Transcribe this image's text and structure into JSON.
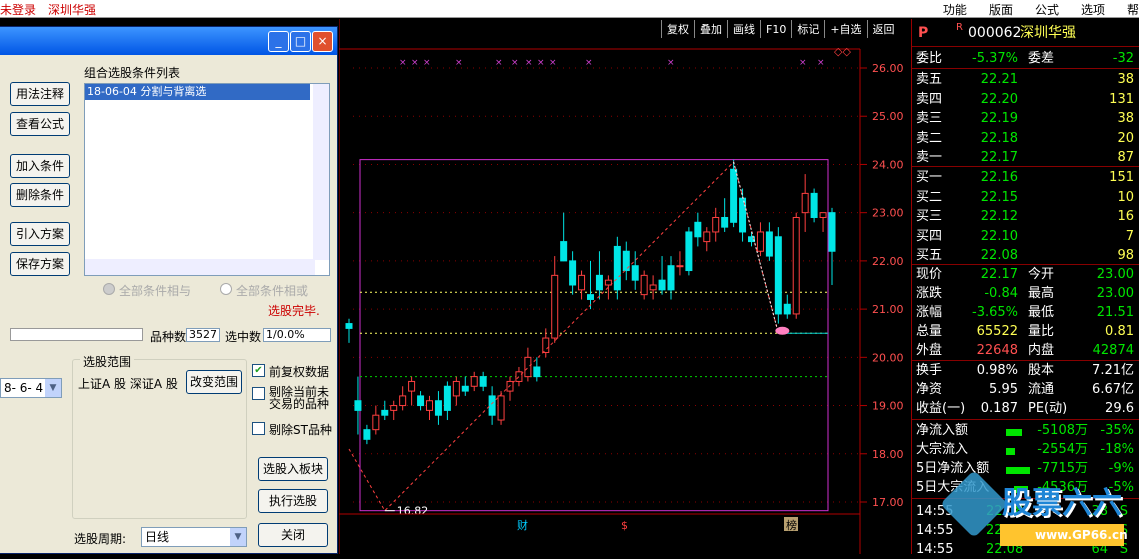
{
  "top": {
    "left1": "未登录",
    "left2": "深圳华强",
    "menu": [
      "功能",
      "版面",
      "公式",
      "选项",
      "帮"
    ]
  },
  "dialog": {
    "title_buttons": [
      "_",
      "□",
      "×"
    ],
    "list_header": "组合选股条件列表",
    "list_item": "18-06-04 分割与背离选",
    "buttons": {
      "usage": "用法注释",
      "view_formula": "查看公式",
      "add": "加入条件",
      "delete": "删除条件",
      "import": "引入方案",
      "save": "保存方案",
      "change_range": "改变范围",
      "to_block": "选股入板块",
      "execute": "执行选股",
      "close": "关闭"
    },
    "radio1": "全部条件相与",
    "radio2": "全部条件相或",
    "done": "选股完毕.",
    "count_label": "品种数",
    "count_value": "3527",
    "select_label": "选中数",
    "select_value": "1/0.0%",
    "range_title": "选股范围",
    "range_value": "上证A 股 深证A 股",
    "date_value": "8- 6- 4",
    "checks": [
      "前复权数据",
      "剔除当前未交易的品种",
      "剔除ST品种"
    ],
    "check_states": [
      true,
      false,
      false
    ],
    "period_label": "选股周期:",
    "period_value": "日线"
  },
  "toolbar": [
    "复权",
    "叠加",
    "画线",
    "F10",
    "标记",
    "+自选",
    "返回"
  ],
  "chart_data": {
    "type": "candlestick",
    "y_ticks": [
      "26.00",
      "25.00",
      "24.00",
      "23.00",
      "22.00",
      "21.00",
      "20.00",
      "19.00",
      "18.00",
      "17.00"
    ],
    "ylim": [
      16.7,
      26.3
    ],
    "min_label": "16.82",
    "bottom_markers": [
      "财",
      "$",
      "榜"
    ],
    "candles": [
      [
        20.7,
        20.8,
        20.3,
        20.6,
        "d"
      ],
      [
        18.9,
        19.6,
        18.4,
        19.1,
        "d"
      ],
      [
        18.5,
        18.6,
        18.2,
        18.3,
        "d"
      ],
      [
        18.8,
        19.0,
        18.4,
        18.5,
        "u"
      ],
      [
        18.9,
        19.1,
        18.7,
        18.8,
        "d"
      ],
      [
        18.9,
        19.1,
        18.7,
        19.0,
        "u"
      ],
      [
        19.0,
        19.4,
        18.9,
        19.2,
        "u"
      ],
      [
        19.3,
        19.6,
        19.0,
        19.5,
        "u"
      ],
      [
        19.2,
        19.3,
        18.9,
        19.0,
        "d"
      ],
      [
        18.9,
        19.2,
        18.7,
        19.1,
        "u"
      ],
      [
        19.1,
        19.3,
        18.6,
        18.8,
        "d"
      ],
      [
        19.4,
        19.5,
        18.7,
        18.9,
        "d"
      ],
      [
        19.2,
        19.6,
        19.0,
        19.5,
        "u"
      ],
      [
        19.4,
        19.6,
        19.2,
        19.3,
        "d"
      ],
      [
        19.4,
        19.7,
        19.3,
        19.6,
        "u"
      ],
      [
        19.6,
        19.7,
        19.3,
        19.4,
        "d"
      ],
      [
        19.2,
        19.4,
        18.6,
        18.8,
        "d"
      ],
      [
        18.7,
        19.3,
        18.6,
        19.2,
        "u"
      ],
      [
        19.3,
        19.6,
        19.1,
        19.5,
        "u"
      ],
      [
        19.5,
        19.8,
        19.4,
        19.7,
        "u"
      ],
      [
        19.6,
        20.2,
        19.5,
        20.0,
        "u"
      ],
      [
        19.8,
        20.0,
        19.5,
        19.6,
        "d"
      ],
      [
        20.1,
        20.6,
        20.0,
        20.4,
        "u"
      ],
      [
        21.7,
        22.1,
        20.3,
        20.4,
        "u"
      ],
      [
        22.4,
        23.0,
        22.0,
        22.0,
        "d"
      ],
      [
        22.0,
        22.2,
        21.3,
        21.5,
        "d"
      ],
      [
        21.4,
        21.8,
        21.2,
        21.7,
        "u"
      ],
      [
        21.3,
        22.0,
        21.0,
        21.2,
        "d"
      ],
      [
        21.7,
        22.2,
        21.2,
        21.4,
        "d"
      ],
      [
        21.5,
        21.7,
        21.2,
        21.6,
        "u"
      ],
      [
        22.3,
        22.5,
        21.2,
        21.4,
        "d"
      ],
      [
        22.2,
        22.4,
        21.6,
        21.8,
        "d"
      ],
      [
        21.9,
        22.2,
        21.4,
        21.6,
        "d"
      ],
      [
        21.3,
        21.8,
        21.2,
        21.7,
        "u"
      ],
      [
        21.4,
        21.7,
        21.2,
        21.5,
        "u"
      ],
      [
        21.6,
        22.1,
        21.3,
        21.4,
        "d"
      ],
      [
        21.9,
        22.1,
        21.2,
        21.4,
        "d"
      ],
      [
        21.9,
        22.2,
        21.7,
        21.9,
        "u"
      ],
      [
        22.6,
        22.7,
        21.7,
        21.8,
        "d"
      ],
      [
        22.8,
        23.0,
        22.3,
        22.5,
        "d"
      ],
      [
        22.4,
        22.7,
        22.2,
        22.6,
        "u"
      ],
      [
        22.6,
        23.1,
        22.4,
        22.9,
        "u"
      ],
      [
        22.9,
        23.3,
        22.6,
        22.7,
        "d"
      ],
      [
        23.9,
        24.1,
        22.7,
        22.8,
        "d"
      ],
      [
        23.3,
        23.5,
        22.4,
        22.6,
        "d"
      ],
      [
        22.5,
        22.6,
        22.3,
        22.4,
        "d"
      ],
      [
        22.2,
        22.8,
        22.1,
        22.6,
        "u"
      ],
      [
        22.6,
        22.8,
        22.0,
        22.1,
        "d"
      ],
      [
        22.5,
        22.7,
        20.7,
        20.9,
        "d"
      ],
      [
        21.1,
        21.3,
        20.8,
        20.9,
        "d"
      ],
      [
        20.9,
        23.0,
        20.8,
        22.9,
        "u"
      ],
      [
        23.0,
        23.8,
        22.6,
        23.4,
        "u"
      ],
      [
        23.4,
        23.5,
        22.8,
        22.9,
        "d"
      ],
      [
        23.0,
        23.0,
        22.6,
        22.9,
        "u"
      ],
      [
        23.0,
        23.1,
        21.5,
        22.2,
        "d"
      ]
    ]
  },
  "quote": {
    "code": "000062",
    "name": "深圳华强",
    "p": "P",
    "r": "R",
    "ratio_label": "委比",
    "ratio": "-5.37%",
    "diff_label": "委差",
    "diff": "-32",
    "sell": [
      {
        "l": "卖五",
        "p": "22.21",
        "v": "38"
      },
      {
        "l": "卖四",
        "p": "22.20",
        "v": "131"
      },
      {
        "l": "卖三",
        "p": "22.19",
        "v": "38"
      },
      {
        "l": "卖二",
        "p": "22.18",
        "v": "20"
      },
      {
        "l": "卖一",
        "p": "22.17",
        "v": "87"
      }
    ],
    "buy": [
      {
        "l": "买一",
        "p": "22.16",
        "v": "151"
      },
      {
        "l": "买二",
        "p": "22.15",
        "v": "10"
      },
      {
        "l": "买三",
        "p": "22.12",
        "v": "16"
      },
      {
        "l": "买四",
        "p": "22.10",
        "v": "7"
      },
      {
        "l": "买五",
        "p": "22.08",
        "v": "98"
      }
    ],
    "stats": [
      [
        "现价",
        "22.17",
        "今开",
        "23.00"
      ],
      [
        "涨跌",
        "-0.84",
        "最高",
        "23.00"
      ],
      [
        "涨幅",
        "-3.65%",
        "最低",
        "21.51"
      ],
      [
        "总量",
        "65522",
        "量比",
        "0.81"
      ],
      [
        "外盘",
        "22648",
        "内盘",
        "42874"
      ]
    ],
    "fund": [
      [
        "换手",
        "0.98%",
        "股本",
        "7.21亿"
      ],
      [
        "净资",
        "5.95",
        "流通",
        "6.67亿"
      ],
      [
        "收益(一)",
        "0.187",
        "PE(动)",
        "29.6"
      ]
    ],
    "flow": [
      [
        "净流入额",
        "-5108万",
        "-35%"
      ],
      [
        "大宗流入",
        "-2554万",
        "-18%"
      ],
      [
        "5日净流入额",
        "-7715万",
        "-9%"
      ],
      [
        "5日大宗流入",
        "-4536万",
        "-5%"
      ]
    ],
    "ticks": [
      [
        "14:55",
        "22.08",
        "38",
        "S"
      ],
      [
        "14:55",
        "22.08",
        "5",
        "S"
      ],
      [
        "14:55",
        "22.08",
        "64",
        "S"
      ]
    ],
    "watermark": "股票六六",
    "watermark_url": "www.GP66.cn"
  }
}
